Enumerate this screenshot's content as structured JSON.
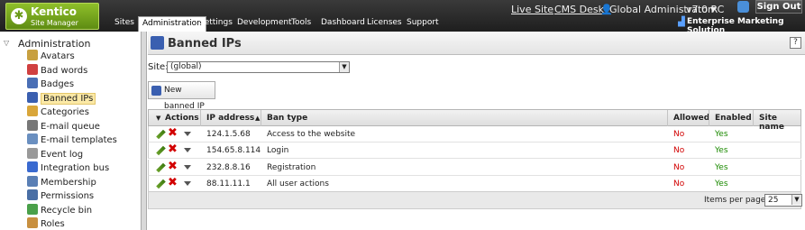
{
  "app": {
    "logo_name": "Kentico",
    "logo_sub": "Site Manager",
    "live_site": "Live Site",
    "cms_desk": "CMS Desk",
    "user": "Global Administrator",
    "version": "v7.0 RC",
    "sign_out": "Sign Out",
    "edition": "Enterprise Marketing Solution"
  },
  "nav": {
    "tabs": [
      "Sites",
      "Administration",
      "Settings",
      "Development",
      "Tools",
      "Dashboard",
      "Licenses",
      "Support"
    ],
    "active": "Administration"
  },
  "sidebar": {
    "root": "Administration",
    "items": [
      {
        "label": "Avatars",
        "icon": "avatar-icon",
        "color": "#c8a040"
      },
      {
        "label": "Bad words",
        "icon": "bad-words-icon",
        "color": "#d04040"
      },
      {
        "label": "Badges",
        "icon": "badge-icon",
        "color": "#4a6fb5"
      },
      {
        "label": "Banned IPs",
        "icon": "banned-ip-icon",
        "color": "#3a5fb0",
        "selected": true
      },
      {
        "label": "Categories",
        "icon": "categories-icon",
        "color": "#d9a63a"
      },
      {
        "label": "E-mail queue",
        "icon": "email-queue-icon",
        "color": "#777"
      },
      {
        "label": "E-mail templates",
        "icon": "email-templates-icon",
        "color": "#6a8fc0"
      },
      {
        "label": "Event log",
        "icon": "event-log-icon",
        "color": "#999"
      },
      {
        "label": "Integration bus",
        "icon": "integration-bus-icon",
        "color": "#3a6ad0"
      },
      {
        "label": "Membership",
        "icon": "membership-icon",
        "color": "#5a7fb5"
      },
      {
        "label": "Permissions",
        "icon": "permissions-icon",
        "color": "#4a6fa5"
      },
      {
        "label": "Recycle bin",
        "icon": "recycle-bin-icon",
        "color": "#4aa04a"
      },
      {
        "label": "Roles",
        "icon": "roles-icon",
        "color": "#c89040"
      }
    ]
  },
  "page": {
    "title": "Banned IPs",
    "help": "?",
    "site_label": "Site:",
    "site_value": "(global)",
    "new_button": "New banned IP"
  },
  "grid": {
    "columns": [
      "Actions",
      "IP address",
      "Ban type",
      "Allowed",
      "Enabled",
      "Site name"
    ],
    "rows": [
      {
        "ip": "124.1.5.68",
        "type": "Access to the website",
        "allowed": "No",
        "enabled": "Yes",
        "site": ""
      },
      {
        "ip": "154.65.8.114",
        "type": "Login",
        "allowed": "No",
        "enabled": "Yes",
        "site": ""
      },
      {
        "ip": "232.8.8.16",
        "type": "Registration",
        "allowed": "No",
        "enabled": "Yes",
        "site": ""
      },
      {
        "ip": "88.11.11.1",
        "type": "All user actions",
        "allowed": "No",
        "enabled": "Yes",
        "site": ""
      }
    ],
    "items_per_page_label": "Items per page:",
    "items_per_page": "25"
  }
}
